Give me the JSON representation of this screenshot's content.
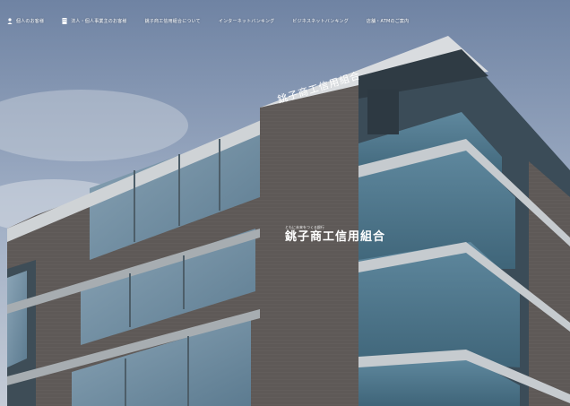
{
  "nav": {
    "items": [
      {
        "label": "個人のお客様",
        "icon": "person-icon"
      },
      {
        "label": "法人・個人事業主のお客様",
        "icon": "building-icon"
      },
      {
        "label": "銚子商工信用組合について",
        "icon": ""
      },
      {
        "label": "インターネットバンキング",
        "icon": ""
      },
      {
        "label": "ビジネスネットバンキング",
        "icon": ""
      },
      {
        "label": "店舗・ATMのご案内",
        "icon": ""
      }
    ]
  },
  "building_sign": "銚子商工信用組合",
  "hero_logo": {
    "subtitle": "ともに未来をつくる銀行",
    "name": "銚子商工信用組合"
  },
  "colors": {
    "sky": "#8d9db5",
    "brick": "#5f5a58",
    "glass": "#6d8fa4",
    "frame": "#bfc4c8"
  }
}
